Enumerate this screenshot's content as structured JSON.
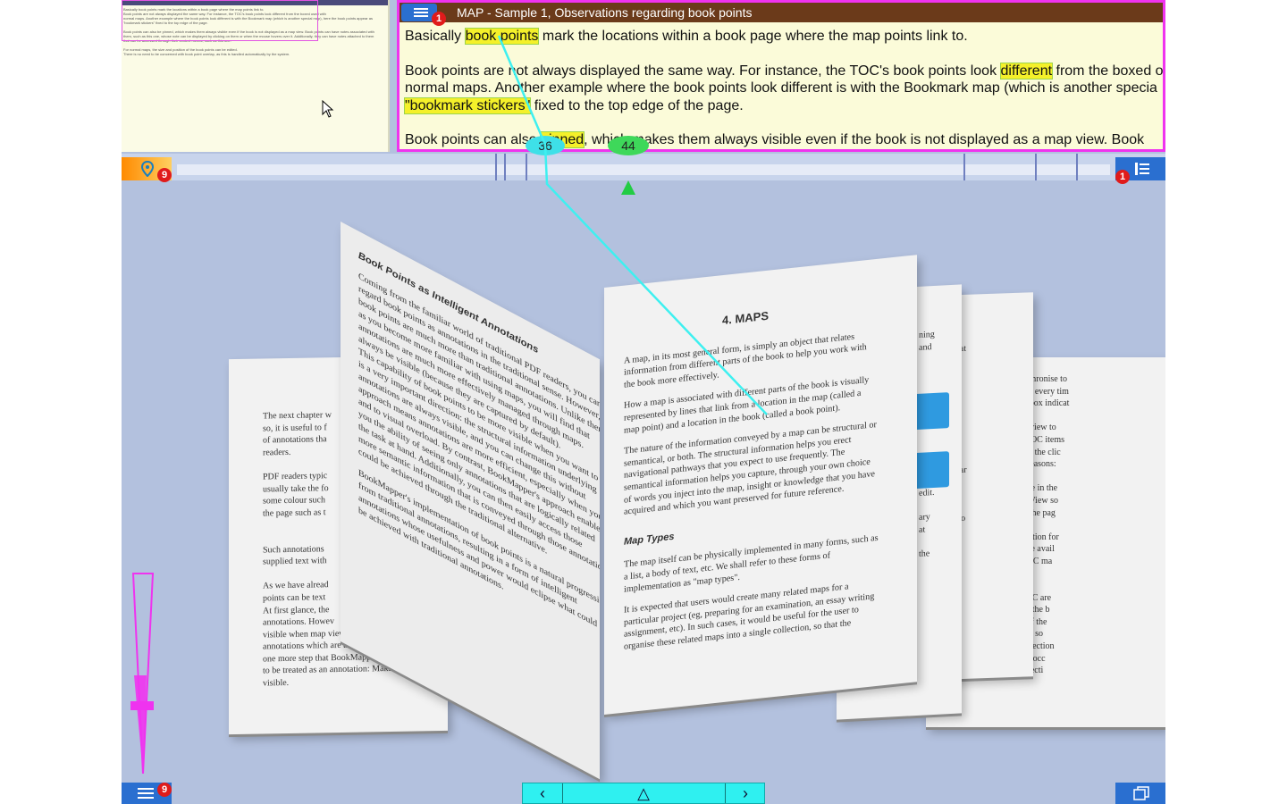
{
  "map": {
    "title": "MAP  -  Sample 1, Observations regarding book points",
    "badge": "1",
    "line1_pre": "Basically ",
    "line1_hl": "book points",
    "line1_post": " mark the locations within a book page where the map points link to.",
    "line2_pre": "Book points are not always displayed the same way.  For instance, the TOC's book points look ",
    "line2_hl": "different",
    "line2_post": " from the boxed o",
    "line3": "normal maps.  Another example where the book points look different is with the Bookmark map (which is another specia",
    "line4_hl": "\"bookmark stickers\"",
    "line4_post": " fixed to the top edge of the page.",
    "line5_pre": "Book points can also ",
    "line5_hl": "pinned",
    "line5_post": ", which makes them always visible even if the book is not displayed as a map view.  Book"
  },
  "timeline": {
    "left_badge": "9",
    "right_badge": "1",
    "pin_a": "36",
    "pin_b": "44"
  },
  "book": {
    "heading": "4.  MAPS",
    "left_heading": "Book Points as Intelligent Annotations",
    "para1": [
      "A map, in its most general form, is simply an object that relates",
      "information from different parts of the book to help you work with",
      "the book more effectively."
    ],
    "para2": [
      "How a map is associated with different parts of the book is visually",
      "represented by lines that link from a location in the map (called a",
      "map point) and a location in the book (called a book point)."
    ],
    "para3": [
      "The nature of the information conveyed by a map can be structural or",
      "semantical, or both.  The structural information helps you erect",
      "navigational pathways that you expect to use frequently.  The",
      "semantical information helps you capture, through your own choice",
      "of words you inject into the map, insight or knowledge that you have",
      "acquired and which you want preserved for future reference."
    ],
    "subheading": "Map Types",
    "para4": [
      "The map itself can be physically implemented in many forms, such as",
      "a list, a body of text, etc.  We shall refer to these forms of",
      "implementation as \"map types\"."
    ],
    "para5": [
      "It is expected that users would create many related maps for a",
      "particular project (eg, preparing for an examination, an essay writing",
      "assignment, etc).  In such cases, it would be useful for the user to",
      "organise these related maps into a single collection, so that the"
    ],
    "left_para": [
      "Coming from the familiar world of traditional PDF readers, you can",
      "regard book points as annotations in the traditional sense.  However,",
      "book points are much more than traditional annotations.  Unlike them,",
      "as you become more familiar with using maps, you will find that",
      "annotations are much more effectively managed through maps.",
      "always be visible (because they are captured by default).",
      "This capability of book points to be more visible when you want to",
      "is a very important direction: the structural information underlying",
      "annotations are always visible, and you can change this without",
      "approach means annotations are more efficient, especially when you",
      "and to visual overload.  By contrast, BookMapper's approach enables",
      "you the ability of seeing only annotations that are logically related",
      "the task at hand.  Additionally, you can then easily access those",
      "more semantic information that is conveyed through those annotations",
      "could be achieved through the traditional alternative."
    ],
    "left_para2": [
      "BookMapper's implementation of book points is a natural progression",
      "from traditional annotations, resulting in a form of intelligent",
      "annotations whose usefulness and power would eclipse what could",
      "be achieved with traditional annotations."
    ],
    "back_left": [
      "The next chapter w",
      "so, it is useful to f",
      "of annotations tha",
      "readers.",
      "",
      "PDF readers typic",
      "usually take the fo",
      "some colour such",
      "the page such as t",
      "",
      "",
      "Such annotations",
      "supplied text with",
      "",
      "As we have alread",
      "points can be text",
      "At first glance, the",
      "annotations.  Howev",
      "visible when map view is",
      "annotations which are always vis",
      "one more step that BookMapper needs",
      "to be treated as an annotation:  Making the b",
      "visible."
    ],
    "back_right": [
      "iew to automatically resynchronise to",
      "of switching to a book view every tim",
      "you can uncheck the checkbox indicat",
      "",
      "need its book to be in map view to",
      "ook view, clicking on the TOC items",
      "o the page corresponding to the clic",
      "course preferred for these reasons:",
      "",
      "ext of where the sections are in the",
      "g context to launch a Page View so",
      "re shown when navigating the pag",
      "",
      "DF file comes with information for",
      "n't, the TOC map will not be avail",
      "anually create your own TOC ma",
      "nap template.",
      "",
      "points associated with a TOC are",
      "f regular maps.  For a TOC, the b",
      "ted arc to signify the start of the",
      "item.  Also take note that for so",
      "drawn precisely above the section",
      "page; this phenomenon can occ",
      "precise coordinates of the secti"
    ],
    "mid_page": [
      "ning",
      "and",
      "",
      "",
      "",
      "",
      "",
      "",
      "",
      "",
      "ing",
      "g",
      "ically",
      "edit.",
      "",
      "ary",
      "at",
      "",
      "the"
    ],
    "mid_page2": [
      "that",
      "he",
      "3:",
      "",
      "",
      "",
      "",
      "",
      "",
      "",
      "ular",
      "",
      "",
      "",
      "s to"
    ]
  },
  "mini_text": "Basically book points mark the locations within a book page where the map points link to.\nBook points are not always displayed the same way. For instance, the TOC's book points look different from the boxed used with\nnormal maps. Another example where the book points look different is with the Bookmark map (which is another special map), here the book points appear as\n\"bookmark stickers\" fixed to the top edge of the page.\n\nBook points can also be pinned, which makes them always visible even if the book is not displayed as a map view. Book points can have notes associated with\nthem, such as this one, whose note can be displayed by clicking on them or when the mouse hovers over it. Additionally, they can have notes attached to them\nthat can be accessed through their context menus, such as this one.\n\nFor normal maps, the size and position of the book points can be edited.\nThere is no need to be concerned with book point overlap, as this is handled automatically by the system.",
  "bottom": {
    "left_badge": "9",
    "prev": "‹",
    "up": "△",
    "next": "›"
  },
  "colors": {
    "accent_magenta": "#ef33ef",
    "button_blue": "#2a6fd0",
    "highlight": "#f4f02a",
    "link_line": "#3ef0f0"
  }
}
